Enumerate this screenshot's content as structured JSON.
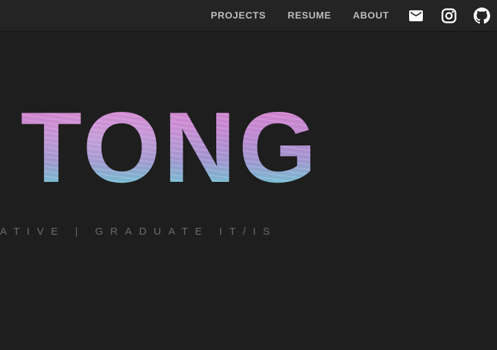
{
  "nav": {
    "links": [
      {
        "label": "PROJECTS"
      },
      {
        "label": "RESUME"
      },
      {
        "label": "ABOUT"
      }
    ],
    "icons": [
      "mail-icon",
      "instagram-icon",
      "github-icon"
    ]
  },
  "hero": {
    "name": "TONG",
    "subtitle": "ATIVE | GRADUATE IT/IS"
  },
  "colors": {
    "background": "#1e1e1e",
    "navbar": "#242424",
    "nav_text": "#bdbdbd",
    "gradient_top": "#e58ad6",
    "gradient_bottom": "#6cd0d8",
    "subtitle_text": "#6c6c6c"
  }
}
